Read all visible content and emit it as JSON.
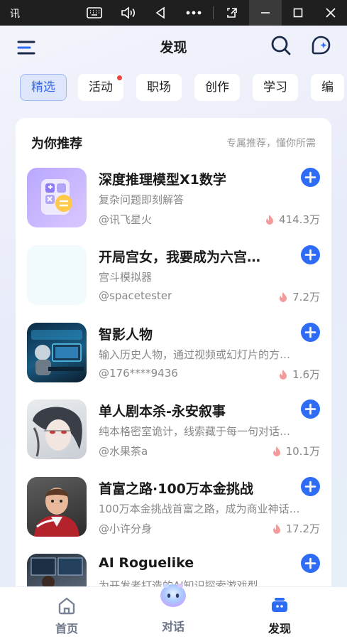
{
  "window": {
    "app_name": "讯",
    "icons": [
      "keyboard-icon",
      "volume-icon",
      "back-triangle-icon",
      "more-dots-icon",
      "screenshot-icon",
      "minimize-icon",
      "maximize-icon",
      "close-icon"
    ]
  },
  "header": {
    "title": "发现",
    "icons": [
      "menu-icon",
      "search-icon",
      "create-agent-icon"
    ]
  },
  "tabs": [
    {
      "label": "精选",
      "selected": true
    },
    {
      "label": "活动",
      "badge": true
    },
    {
      "label": "职场"
    },
    {
      "label": "创作"
    },
    {
      "label": "学习"
    },
    {
      "label": "编"
    }
  ],
  "section": {
    "title": "为你推荐",
    "subtitle": "专属推荐，懂你所需"
  },
  "items": [
    {
      "title": "深度推理模型X1数学",
      "desc": "复杂问题即刻解答",
      "author": "@讯飞星火",
      "heat": "414.3万"
    },
    {
      "title": "开局宫女，我要成为六宫…",
      "desc": "宫斗模拟器",
      "author": "@spacetester",
      "heat": "7.2万"
    },
    {
      "title": "智影人物",
      "desc": "输入历史人物，通过视频或幻灯片的方…",
      "author": "@176****9436",
      "heat": "1.6万"
    },
    {
      "title": "单人剧本杀-永安叙事",
      "desc": "纯本格密室诡计，线索藏于每一句对话…",
      "author": "@水果茶a",
      "heat": "10.1万"
    },
    {
      "title": "首富之路·100万本金挑战",
      "desc": "100万本金挑战首富之路，成为商业神话…",
      "author": "@小许分身",
      "heat": "17.2万"
    },
    {
      "title": "AI Roguelike",
      "desc": "为开发者打造的AI知识探索游戏型…",
      "author": "",
      "heat": ""
    }
  ],
  "bottom_nav": [
    {
      "label": "首页",
      "icon": "home-icon",
      "active": false
    },
    {
      "label": "对话",
      "icon": "assistant-avatar-icon",
      "active": false
    },
    {
      "label": "发现",
      "icon": "discover-icon",
      "active": true
    }
  ],
  "colors": {
    "accent": "#2f6cf6",
    "heat": "#f26d6d",
    "tab_selected_bg": "#dde6fb"
  }
}
